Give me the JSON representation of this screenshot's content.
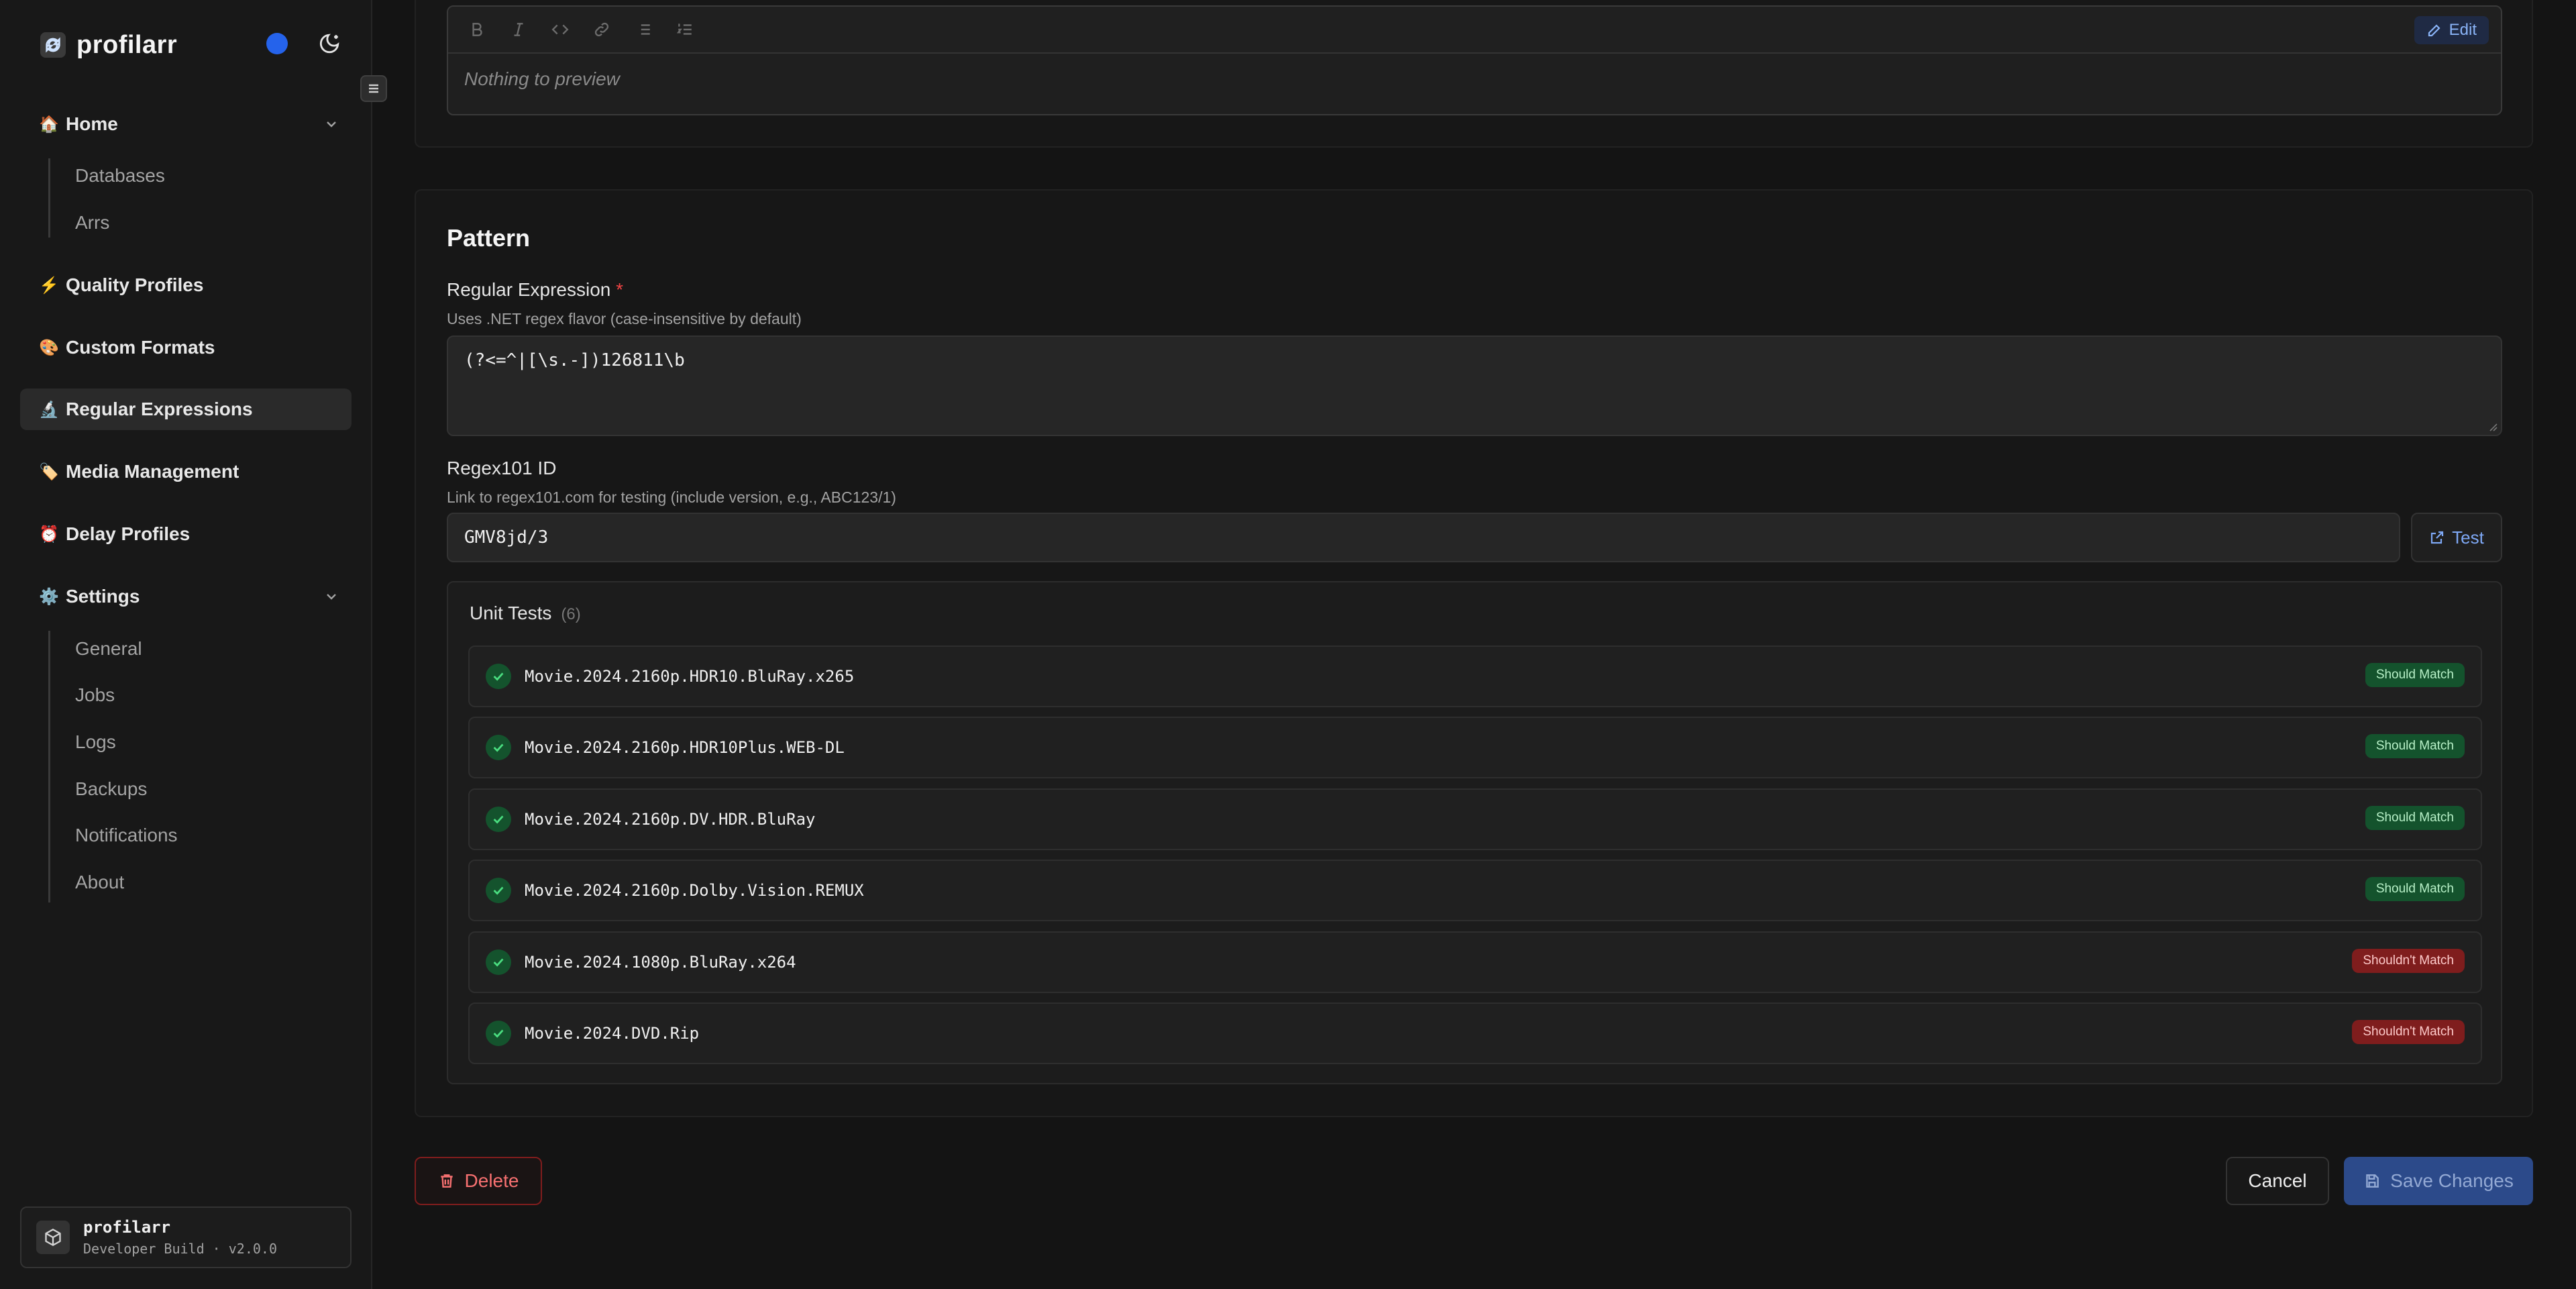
{
  "app": {
    "name": "profilarr"
  },
  "sidebar": {
    "nav": [
      {
        "label": "Home",
        "emoji": "🏠",
        "expanded": true
      },
      {
        "label": "Quality Profiles",
        "emoji": "⚡"
      },
      {
        "label": "Custom Formats",
        "emoji": "🎨"
      },
      {
        "label": "Regular Expressions",
        "emoji": "🔬",
        "active": true
      },
      {
        "label": "Media Management",
        "emoji": "🏷️"
      },
      {
        "label": "Delay Profiles",
        "emoji": "⏰"
      },
      {
        "label": "Settings",
        "emoji": "⚙️",
        "expanded": true
      }
    ],
    "home_children": [
      "Databases",
      "Arrs"
    ],
    "settings_children": [
      "General",
      "Jobs",
      "Logs",
      "Backups",
      "Notifications",
      "About"
    ]
  },
  "build": {
    "name": "profilarr",
    "version": "Developer Build · v2.0.0"
  },
  "editor": {
    "edit_label": "Edit",
    "preview_placeholder": "Nothing to preview"
  },
  "pattern": {
    "title": "Pattern",
    "regex_label": "Regular Expression",
    "regex_required": "*",
    "regex_help": "Uses .NET regex flavor (case-insensitive by default)",
    "regex_value": "(?<=^|[\\s.-])126811\\b",
    "regex101_label": "Regex101 ID",
    "regex101_help": "Link to regex101.com for testing (include version, e.g., ABC123/1)",
    "regex101_value": "GMV8jd/3",
    "test_label": "Test"
  },
  "unit_tests": {
    "title": "Unit Tests",
    "count": "(6)",
    "rows": [
      {
        "text": "Movie.2024.2160p.HDR10.BluRay.x265",
        "badge": "Should Match",
        "type": "match"
      },
      {
        "text": "Movie.2024.2160p.HDR10Plus.WEB-DL",
        "badge": "Should Match",
        "type": "match"
      },
      {
        "text": "Movie.2024.2160p.DV.HDR.BluRay",
        "badge": "Should Match",
        "type": "match"
      },
      {
        "text": "Movie.2024.2160p.Dolby.Vision.REMUX",
        "badge": "Should Match",
        "type": "match"
      },
      {
        "text": "Movie.2024.1080p.BluRay.x264",
        "badge": "Shouldn't Match",
        "type": "nomatch"
      },
      {
        "text": "Movie.2024.DVD.Rip",
        "badge": "Shouldn't Match",
        "type": "nomatch"
      }
    ]
  },
  "actions": {
    "delete": "Delete",
    "cancel": "Cancel",
    "save": "Save Changes"
  },
  "colors": {
    "accent": "#2563eb",
    "danger": "#ef4444",
    "success": "#14532d"
  }
}
